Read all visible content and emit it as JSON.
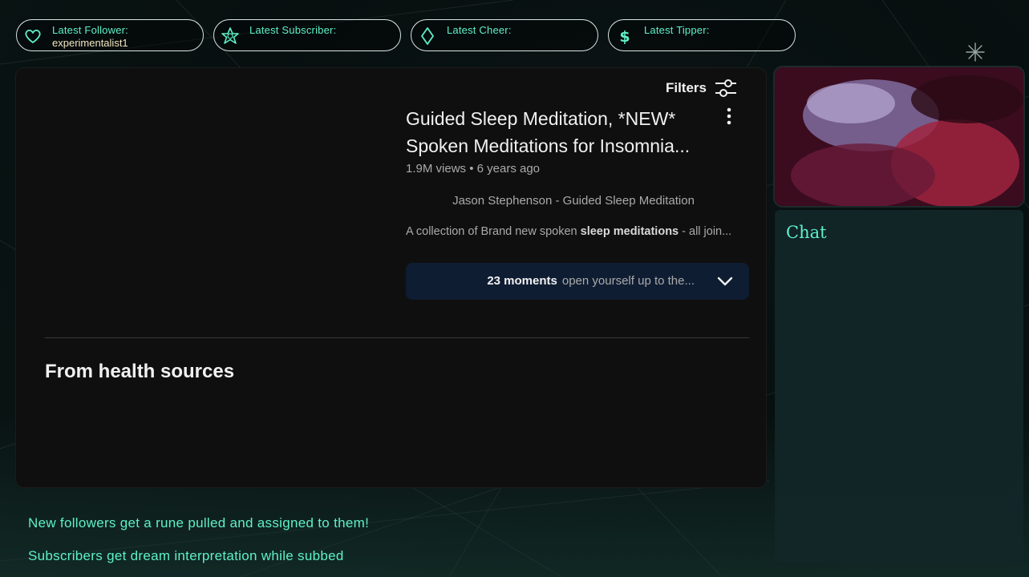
{
  "alerts": [
    {
      "label": "Latest Follower:",
      "value": "experimentalist1",
      "icon": "heart-icon"
    },
    {
      "label": "Latest Subscriber:",
      "value": "",
      "icon": "star-icon"
    },
    {
      "label": "Latest Cheer:",
      "value": "",
      "icon": "diamond-icon"
    },
    {
      "label": "Latest Tipper:",
      "value": "",
      "icon": "dollar-icon"
    }
  ],
  "video": {
    "filters_label": "Filters",
    "title_line1": "Guided Sleep Meditation, *NEW*",
    "title_line2": "Spoken Meditations for Insomnia...",
    "views": "1.9M views",
    "age": "6 years ago",
    "channel": "Jason Stephenson - Guided Sleep Meditation",
    "desc_pre": "A collection of Brand new spoken ",
    "desc_bold": "sleep meditations",
    "desc_post": " - all join...",
    "moments_count": "23 moments",
    "moments_text": "open yourself up to the..."
  },
  "section_title": "From health sources",
  "chat": {
    "title": "Chat"
  },
  "rules": [
    "New followers get a rune pulled and assigned to them!",
    "Subscribers get dream interpretation while subbed"
  ],
  "colors": {
    "accent": "#5ff0c8",
    "value_text": "#f3e6c0",
    "panel_bg": "#0f0f0f",
    "moments_bg": "#0f1d33"
  }
}
